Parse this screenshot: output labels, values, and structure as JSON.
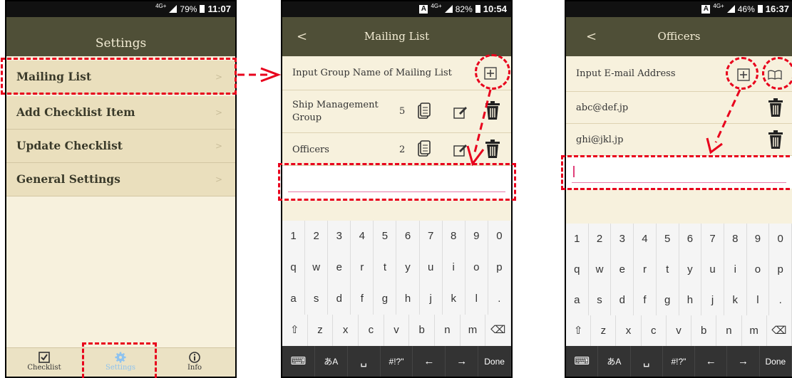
{
  "screen1": {
    "status": {
      "network": "4G+",
      "battery": "79%",
      "time": "11:07"
    },
    "title": "Settings",
    "menu": [
      {
        "label": "Mailing List",
        "chevron": ">"
      },
      {
        "label": "Add Checklist Item",
        "chevron": ">"
      },
      {
        "label": "Update Checklist",
        "chevron": ">"
      },
      {
        "label": "General Settings",
        "chevron": ">"
      }
    ],
    "tabs": [
      {
        "label": "Checklist",
        "icon": "checkbox-icon"
      },
      {
        "label": "Settings",
        "icon": "gear-icon"
      },
      {
        "label": "Info",
        "icon": "info-icon"
      }
    ]
  },
  "screen2": {
    "status": {
      "network": "4G+",
      "battery": "82%",
      "time": "10:54",
      "indicator": "A"
    },
    "title": "Mailing List",
    "back": "<",
    "input_placeholder": "Input Group Name of Mailing List",
    "groups": [
      {
        "name": "Ship Management Group",
        "count": "5"
      },
      {
        "name": "Officers",
        "count": "2"
      }
    ]
  },
  "screen3": {
    "status": {
      "network": "4G+",
      "battery": "46%",
      "time": "16:37",
      "indicator": "A"
    },
    "title": "Officers",
    "back": "<",
    "input_placeholder": "Input E-mail Address",
    "emails": [
      "abc@def.jp",
      "ghi@jkl.jp"
    ]
  },
  "keyboard": {
    "numbers": [
      "1",
      "2",
      "3",
      "4",
      "5",
      "6",
      "7",
      "8",
      "9",
      "0"
    ],
    "row1": [
      "q",
      "w",
      "e",
      "r",
      "t",
      "y",
      "u",
      "i",
      "o",
      "p"
    ],
    "row2": [
      "a",
      "s",
      "d",
      "f",
      "g",
      "h",
      "j",
      "k",
      "l",
      "."
    ],
    "row3": [
      "⇧",
      "z",
      "x",
      "c",
      "v",
      "b",
      "n",
      "m",
      "⌫"
    ],
    "bottom": [
      "⌨",
      "あA",
      "␣",
      "#!?\"",
      "←",
      "→",
      "Done"
    ]
  },
  "colors": {
    "header": "#4f4f37",
    "menu_bg": "#eadfbd",
    "page_bg": "#f7f1dd",
    "annotation": "#e8001c",
    "active_tab": "#8fc3ee"
  }
}
